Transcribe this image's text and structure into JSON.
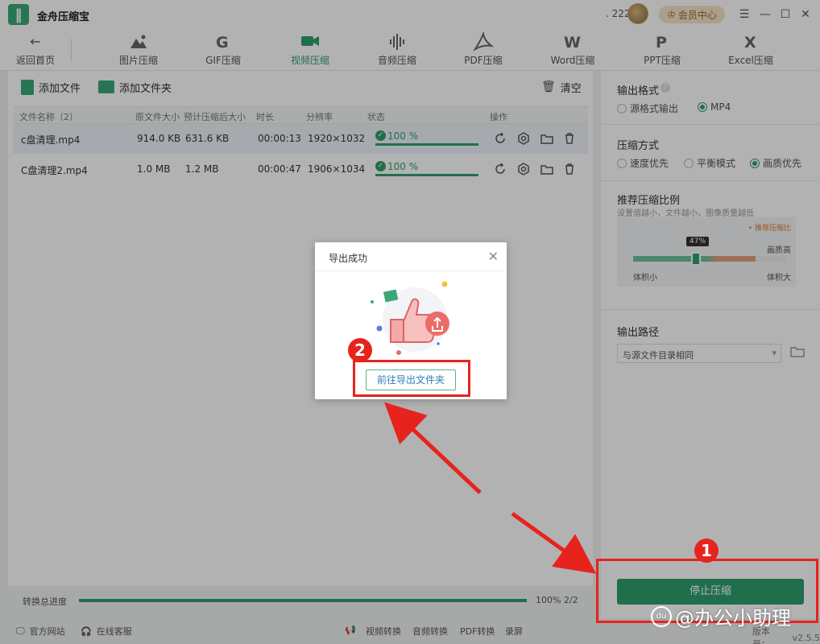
{
  "app": {
    "title": "金舟压缩宝",
    "user_count": "222",
    "vip_label": "会员中心",
    "version_label": "版本号：",
    "version": "v2.5.5"
  },
  "toolbar": {
    "back_label": "返回首页",
    "tools": [
      {
        "label": "图片压缩",
        "icon": "image-compress-icon"
      },
      {
        "label": "GIF压缩",
        "icon": "gif-compress-icon"
      },
      {
        "label": "视频压缩",
        "icon": "video-compress-icon",
        "active": true
      },
      {
        "label": "音频压缩",
        "icon": "audio-compress-icon"
      },
      {
        "label": "PDF压缩",
        "icon": "pdf-compress-icon"
      },
      {
        "label": "Word压缩",
        "icon": "word-compress-icon"
      },
      {
        "label": "PPT压缩",
        "icon": "ppt-compress-icon"
      },
      {
        "label": "Excel压缩",
        "icon": "excel-compress-icon"
      }
    ]
  },
  "file_panel": {
    "add_file": "添加文件",
    "add_folder": "添加文件夹",
    "clear": "清空",
    "columns": [
      "文件名称（2）",
      "原文件大小",
      "预计压缩后大小",
      "时长",
      "分辨率",
      "状态",
      "操作"
    ],
    "rows": [
      {
        "name": "c盘清理.mp4",
        "orig_size": "914.0 KB",
        "est_size": "631.6 KB",
        "duration": "00:00:13",
        "resolution": "1920×1032",
        "status": "100 %",
        "progress": 1.0
      },
      {
        "name": "C盘清理2.mp4",
        "orig_size": "1.0 MB",
        "est_size": "1.2 MB",
        "duration": "00:00:47",
        "resolution": "1906×1034",
        "status": "100 %",
        "progress": 1.0
      }
    ]
  },
  "settings": {
    "output_format": {
      "title": "输出格式",
      "options": [
        "源格式输出",
        "MP4"
      ],
      "selected": "MP4"
    },
    "compress_mode": {
      "title": "压缩方式",
      "options": [
        "速度优先",
        "平衡模式",
        "画质优先"
      ],
      "selected": "画质优先"
    },
    "ratio": {
      "title": "推荐压缩比例",
      "hint": "设置值越小，文件越小，图像质量越低",
      "recommend_label": "• 推荐压缩比",
      "value_label": "47%",
      "value": 0.47,
      "high_quality_label": "画质高",
      "min_label": "体积小",
      "max_label": "体积大"
    },
    "output_path": {
      "title": "输出路径",
      "value": "与源文件目录相同"
    },
    "stop_button": "停止压缩"
  },
  "progress": {
    "label": "转换总进度",
    "value_text": "100% 2/2",
    "fraction": 1.0
  },
  "bottom_bar": {
    "official_site": "官方网站",
    "online_service": "在线客服",
    "links": [
      "视频转换",
      "音频转换",
      "PDF转换",
      "录屏"
    ]
  },
  "dialog": {
    "title": "导出成功",
    "button": "前往导出文件夹"
  },
  "annotations": {
    "badge1": "1",
    "badge2": "2"
  },
  "watermark": {
    "logo": "du",
    "text": "@办公小助理"
  },
  "colors": {
    "accent": "#2f9f6e",
    "annotation": "#e7231d",
    "vip": "#f5e3c7"
  }
}
